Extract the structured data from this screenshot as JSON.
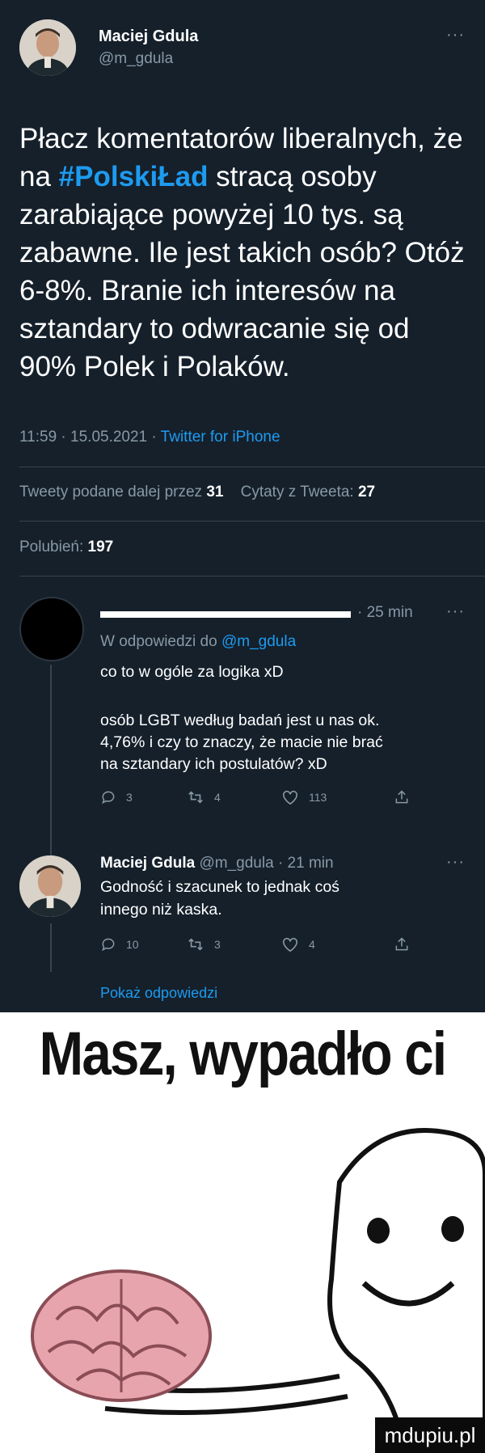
{
  "tweet": {
    "author_name": "Maciej Gdula",
    "author_handle": "@m_gdula",
    "menu": "···",
    "text_before_hashtag": "Płacz komentatorów liberalnych, że na ",
    "hashtag": "#PolskiŁad",
    "text_after_hashtag": " stracą osoby zarabiające powyżej 10 tys. są zabawne. Ile jest takich osób? Otóż 6-8%. Branie ich interesów na sztandary to odwracanie się od 90% Polek i Polaków.",
    "time": "11:59",
    "date": "15.05.2021",
    "source": "Twitter for iPhone",
    "retweets_label": "Tweety podane dalej przez",
    "retweets_count": "31",
    "quotes_label": "Cytaty z Tweeta:",
    "quotes_count": "27",
    "likes_label": "Polubień:",
    "likes_count": "197"
  },
  "reply1": {
    "time": "· 25 min",
    "menu": "···",
    "replying_to_prefix": "W odpowiedzi do ",
    "replying_to_handle": "@m_gdula",
    "line1": "co to w ogóle za logika xD",
    "line2": "osób LGBT według badań jest u nas ok.",
    "line3": "4,76% i czy to znaczy, że macie nie brać",
    "line4": "na sztandary ich postulatów? xD",
    "replies": "3",
    "retweets": "4",
    "likes": "113"
  },
  "reply2": {
    "author_name": "Maciej Gdula",
    "author_handle": "@m_gdula",
    "time": "· 21 min",
    "menu": "···",
    "line1": "Godność i szacunek to jednak coś",
    "line2": "innego niż kaska.",
    "replies": "10",
    "retweets": "3",
    "likes": "4"
  },
  "show_replies": "Pokaż odpowiedzi",
  "meme": {
    "caption": "Masz, wypadło ci",
    "watermark": "mdupiu.pl"
  },
  "colors": {
    "background": "#15202b",
    "accent": "#1d9bf0",
    "secondary_text": "#8899a6"
  }
}
